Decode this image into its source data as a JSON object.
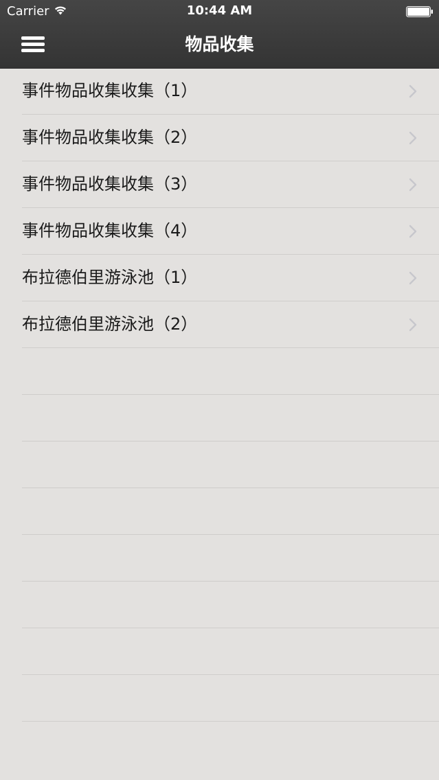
{
  "status_bar": {
    "carrier": "Carrier",
    "time": "10:44 AM",
    "wifi_icon": "wifi-icon",
    "battery_icon": "battery-icon"
  },
  "nav": {
    "title": "物品收集",
    "menu_icon": "hamburger-menu-icon"
  },
  "list": {
    "items": [
      {
        "label": "事件物品收集收集（1）"
      },
      {
        "label": "事件物品收集收集（2）"
      },
      {
        "label": "事件物品收集收集（3）"
      },
      {
        "label": "事件物品收集收集（4）"
      },
      {
        "label": "布拉德伯里游泳池（1）"
      },
      {
        "label": "布拉德伯里游泳池（2）"
      }
    ],
    "row_icon": "chevron-right-icon"
  },
  "colors": {
    "nav_background": "#3d3d3d",
    "page_background": "#e3e1df",
    "separator": "#cfcdcb",
    "chevron": "#c7c7cc"
  }
}
